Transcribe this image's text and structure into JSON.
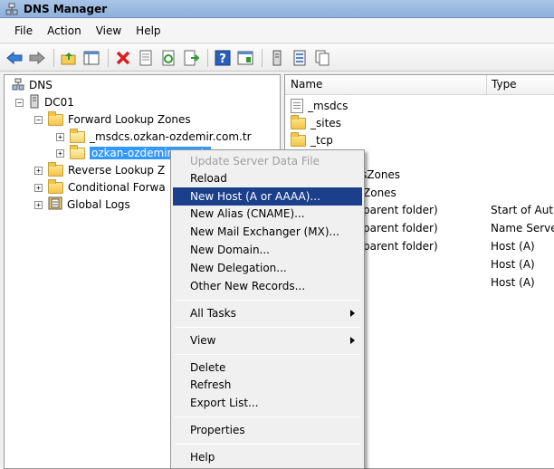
{
  "window": {
    "title": "DNS Manager"
  },
  "menu": [
    "File",
    "Action",
    "View",
    "Help"
  ],
  "toolbar": [
    "back-icon",
    "forward-icon",
    "up-folder-icon",
    "show-hide-tree-icon",
    "delete-icon",
    "properties-icon",
    "refresh-icon",
    "export-icon",
    "help-icon",
    "console-icon",
    "server-icon",
    "list-icon",
    "copy-icon"
  ],
  "tree": {
    "root": "DNS",
    "server": "DC01",
    "forward_zones": "Forward Lookup Zones",
    "msdcs_zone": "_msdcs.ozkan-ozdemir.com.tr",
    "selected_zone": "ozkan-ozdemir.com.tr",
    "reverse_zones": "Reverse Lookup Z",
    "conditional": "Conditional Forwa",
    "global_logs": "Global Logs"
  },
  "list": {
    "columns": [
      "Name",
      "Type"
    ],
    "rows": [
      {
        "name": "_msdcs",
        "type": "",
        "icon": "doc-icon"
      },
      {
        "name": "_sites",
        "type": "",
        "icon": "folder-icon"
      },
      {
        "name": "_tcp",
        "type": "",
        "icon": "folder-icon"
      },
      {
        "name": "",
        "type": "",
        "icon": ""
      },
      {
        "name": "sZones",
        "type": ""
      },
      {
        "name": "Zones",
        "type": ""
      },
      {
        "name": "parent folder)",
        "type": "Start of Aut"
      },
      {
        "name": "parent folder)",
        "type": "Name Serve"
      },
      {
        "name": "parent folder)",
        "type": "Host (A)"
      },
      {
        "name": "",
        "type": "Host (A)"
      },
      {
        "name": "",
        "type": "Host (A)"
      }
    ]
  },
  "context_menu": {
    "update": "Update Server Data File",
    "reload": "Reload",
    "new_host": "New Host (A or AAAA)...",
    "new_alias": "New Alias (CNAME)...",
    "new_mx": "New Mail Exchanger (MX)...",
    "new_domain": "New Domain...",
    "new_delegation": "New Delegation...",
    "other_records": "Other New Records...",
    "all_tasks": "All Tasks",
    "view": "View",
    "delete": "Delete",
    "refresh": "Refresh",
    "export": "Export List...",
    "properties": "Properties",
    "help": "Help"
  }
}
